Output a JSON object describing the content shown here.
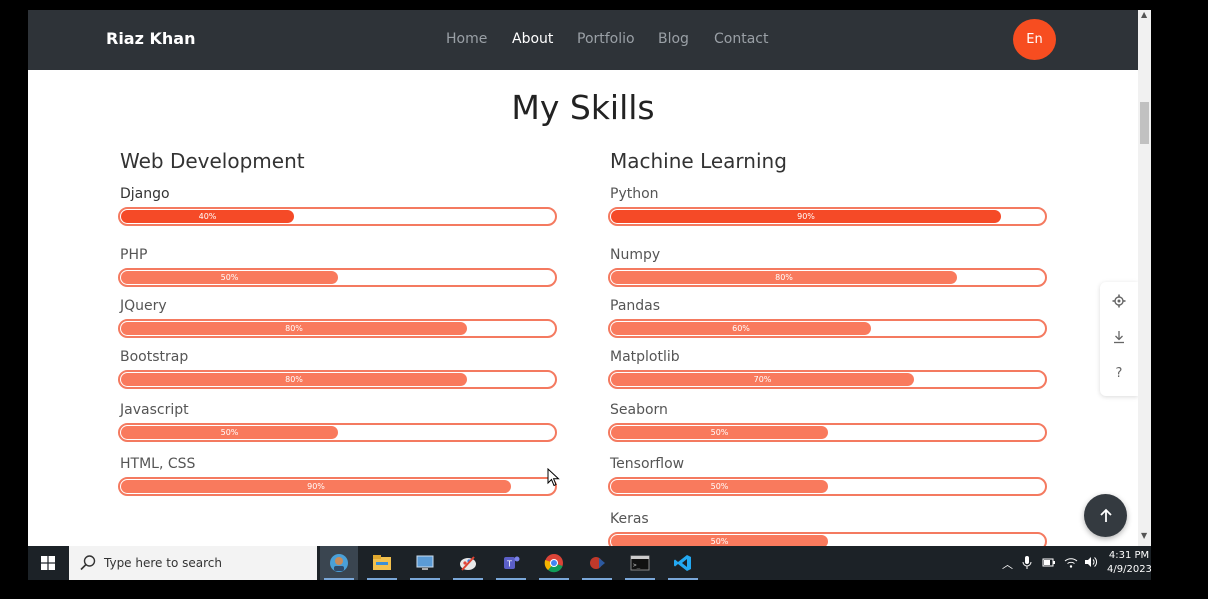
{
  "navbar": {
    "brand": "Riaz Khan",
    "links": [
      "Home",
      "About",
      "Portfolio",
      "Blog",
      "Contact"
    ],
    "active": "About",
    "language_button": "En"
  },
  "section": {
    "title": "My Skills"
  },
  "columns": [
    {
      "title": "Web Development",
      "skills": [
        {
          "label": "Django",
          "percent_label": "40%",
          "percent": 40
        },
        {
          "label": "PHP",
          "percent_label": "50%",
          "percent": 50
        },
        {
          "label": "JQuery",
          "percent_label": "80%",
          "percent": 80
        },
        {
          "label": "Bootstrap",
          "percent_label": "80%",
          "percent": 80
        },
        {
          "label": "Javascript",
          "percent_label": "50%",
          "percent": 50
        },
        {
          "label": "HTML, CSS",
          "percent_label": "90%",
          "percent": 90
        }
      ]
    },
    {
      "title": "Machine Learning",
      "skills": [
        {
          "label": "Python",
          "percent_label": "90%",
          "percent": 90
        },
        {
          "label": "Numpy",
          "percent_label": "80%",
          "percent": 80
        },
        {
          "label": "Pandas",
          "percent_label": "60%",
          "percent": 60
        },
        {
          "label": "Matplotlib",
          "percent_label": "70%",
          "percent": 70
        },
        {
          "label": "Seaborn",
          "percent_label": "50%",
          "percent": 50
        },
        {
          "label": "Tensorflow",
          "percent_label": "50%",
          "percent": 50
        },
        {
          "label": "Keras",
          "percent_label": "50%",
          "percent": 50
        }
      ]
    }
  ],
  "side_panel": {
    "icons": [
      "gear-icon",
      "download-icon",
      "help-icon"
    ]
  },
  "colors": {
    "accent": "#f74d20",
    "navbar": "#2e3338",
    "bar_fill": "#f97a5d"
  },
  "taskbar": {
    "search_placeholder": "Type here to search",
    "apps": [
      "cortana-icon",
      "file-explorer-icon",
      "remote-desktop-icon",
      "paint-icon",
      "teams-icon",
      "chrome-icon",
      "app-icon",
      "terminal-icon",
      "vscode-icon"
    ],
    "time": "4:31 PM",
    "date": "4/9/2023"
  }
}
